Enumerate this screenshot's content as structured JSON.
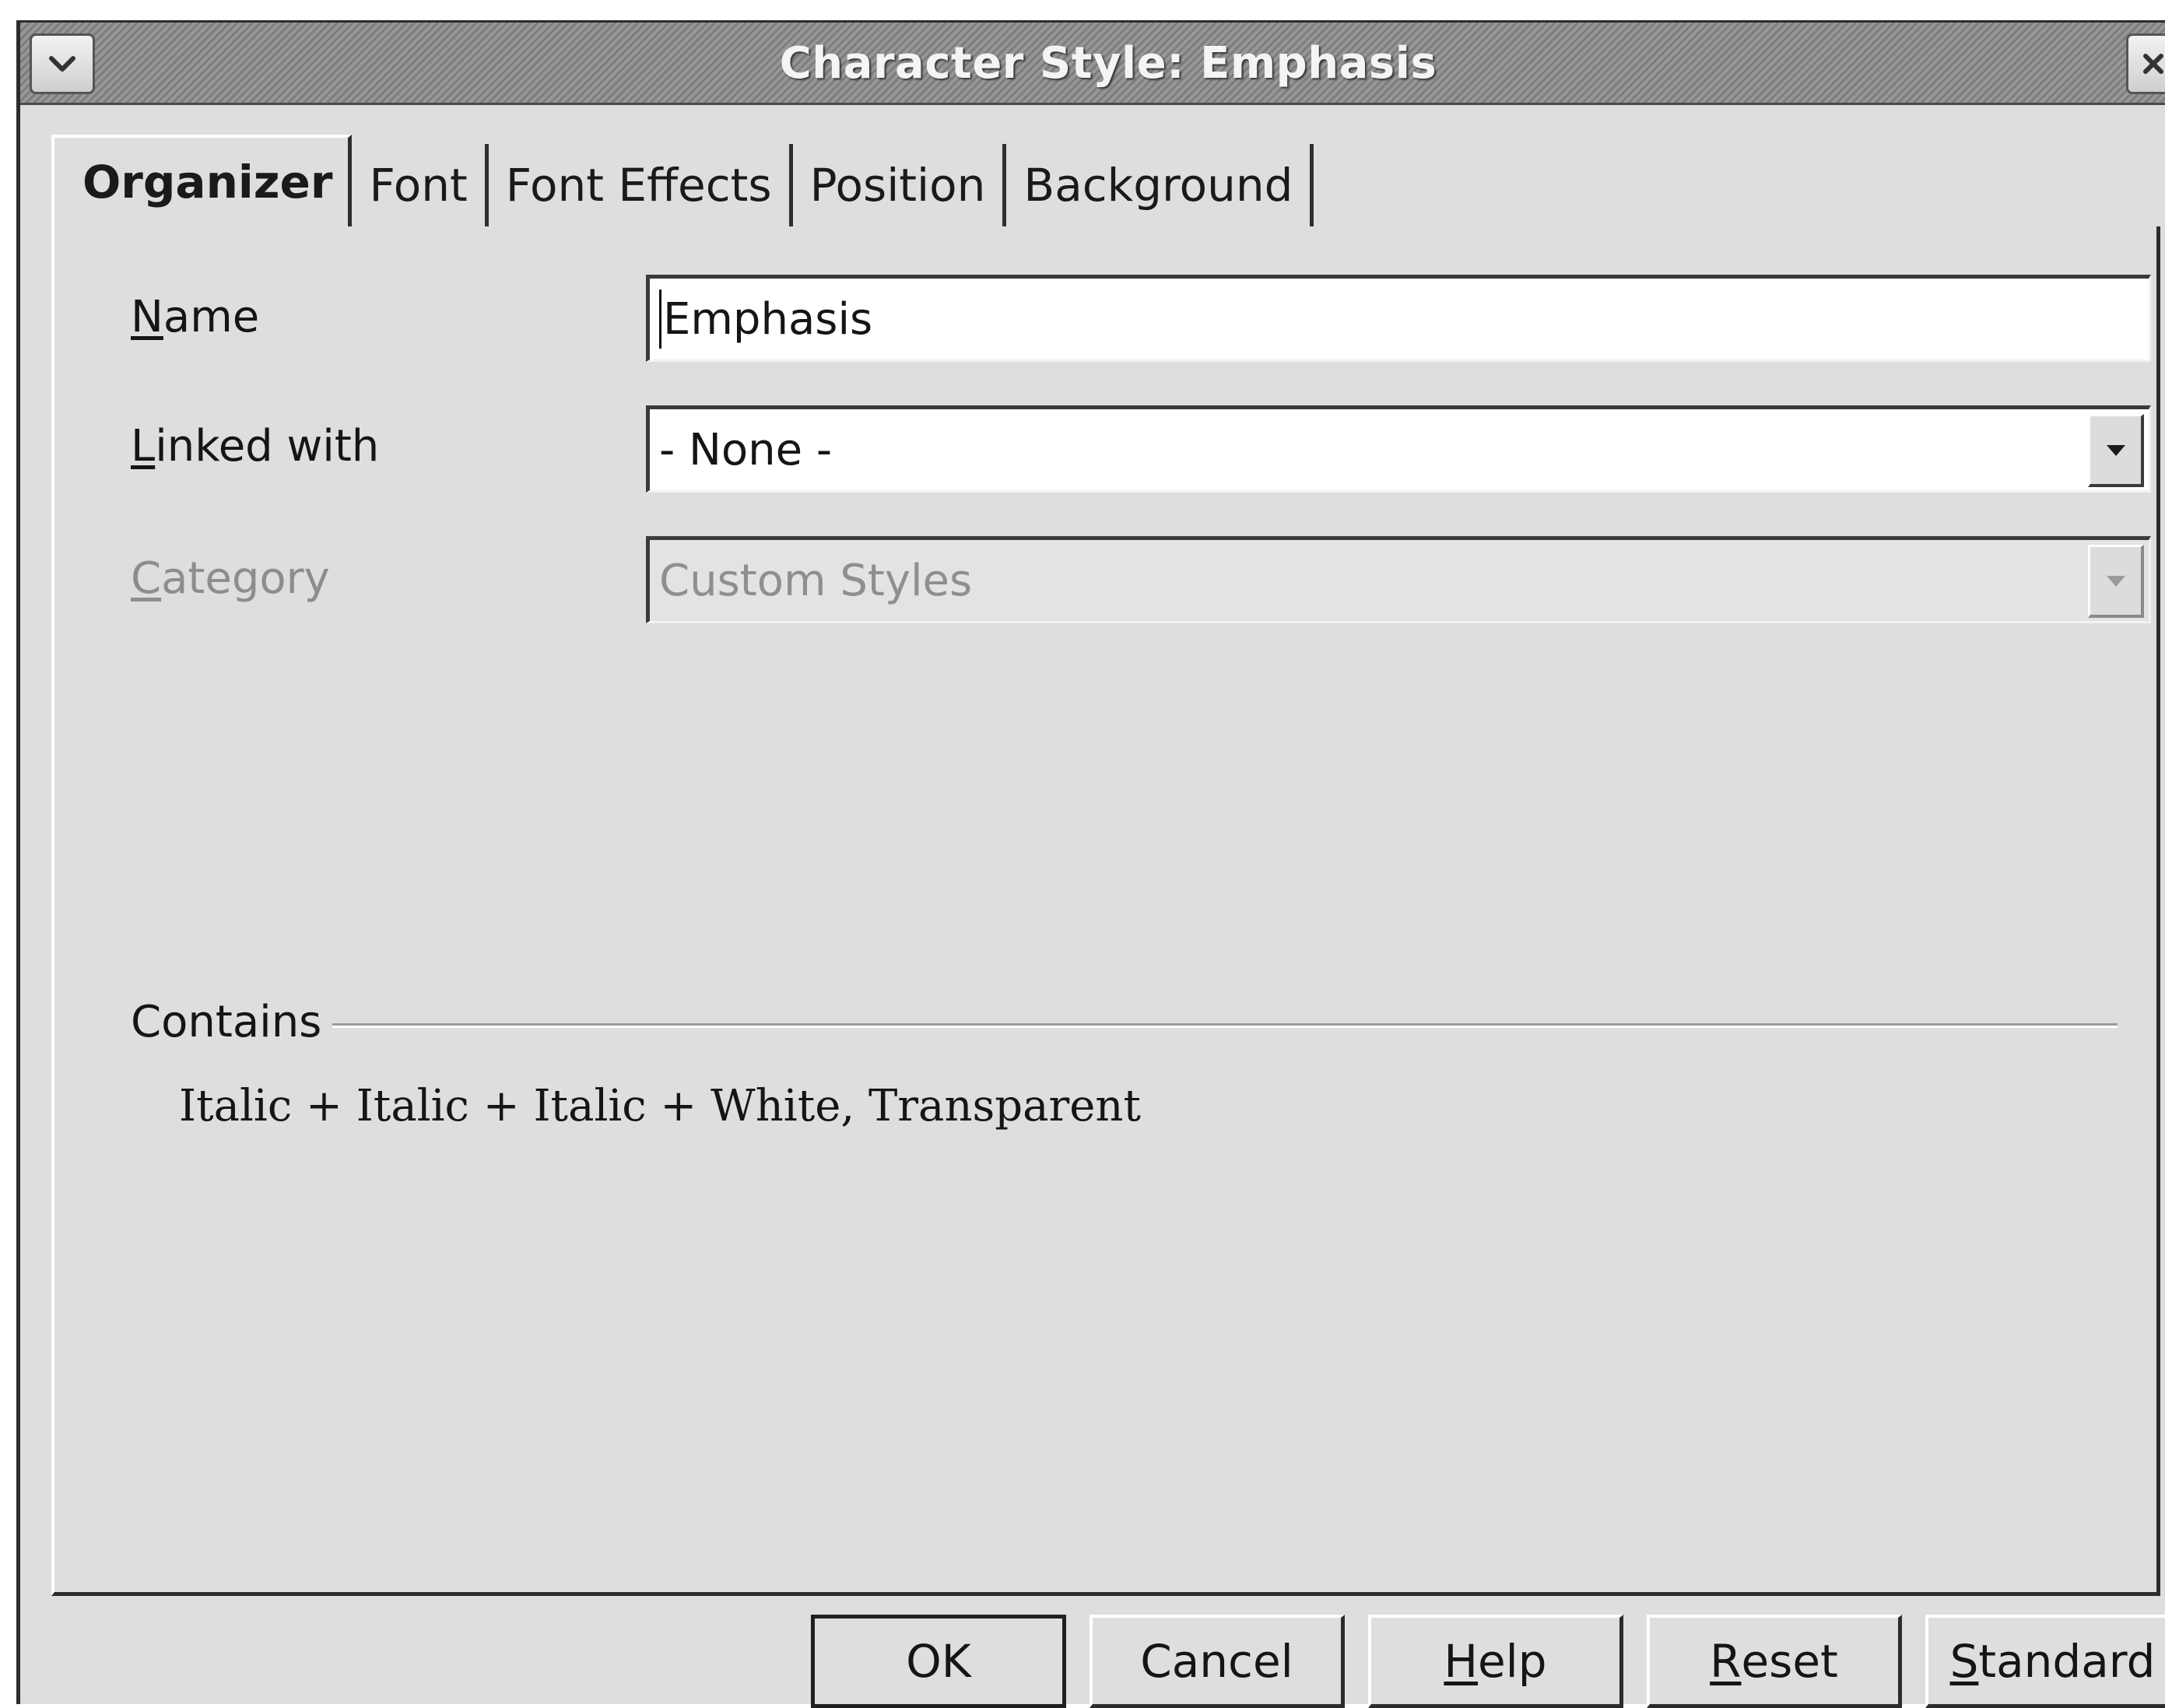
{
  "window": {
    "title": "Character Style: Emphasis"
  },
  "title_icons": {
    "menu": "chevron-down-icon",
    "close": "close-icon"
  },
  "tabs": [
    {
      "label": "Organizer",
      "active": true
    },
    {
      "label": "Font",
      "active": false
    },
    {
      "label": "Font Effects",
      "active": false
    },
    {
      "label": "Position",
      "active": false
    },
    {
      "label": "Background",
      "active": false
    }
  ],
  "organizer": {
    "name": {
      "label_mnemonic": "N",
      "label_rest": "ame",
      "value": "Emphasis"
    },
    "linked_with": {
      "label_mnemonic": "L",
      "label_rest": "inked with",
      "value": "- None -"
    },
    "category": {
      "label_mnemonic": "C",
      "label_rest": "ategory",
      "value": "Custom Styles",
      "enabled": false
    },
    "contains": {
      "label": "Contains",
      "value": "Italic + Italic + Italic + White, Transparent"
    }
  },
  "buttons": {
    "ok": {
      "label": "OK"
    },
    "cancel": {
      "label": "Cancel"
    },
    "help": {
      "mnemonic": "H",
      "rest": "elp"
    },
    "reset": {
      "mnemonic": "R",
      "rest": "eset"
    },
    "standard": {
      "mnemonic": "S",
      "rest": "tandard"
    }
  },
  "colors": {
    "dialog_bg": "#dedede",
    "title_text": "#f4f4f4",
    "disabled_text": "#8d8d8d"
  }
}
